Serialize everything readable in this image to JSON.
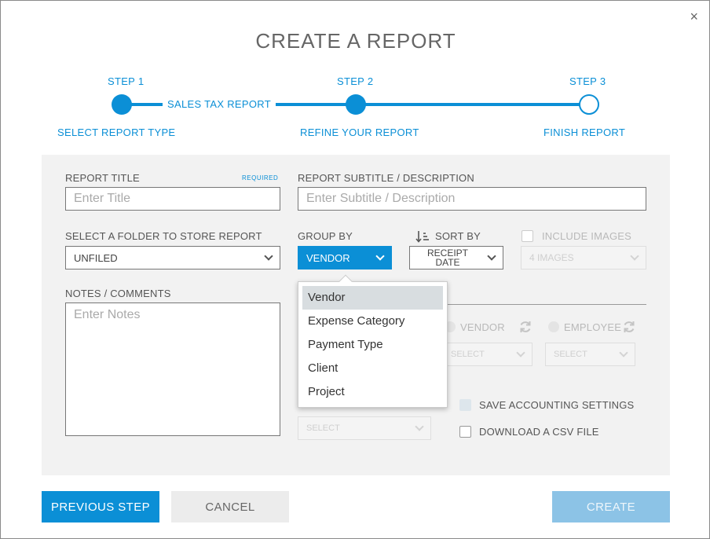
{
  "modal": {
    "title": "CREATE A REPORT",
    "close_glyph": "×"
  },
  "stepper": {
    "steps": [
      {
        "label": "STEP 1",
        "desc": "SELECT REPORT TYPE"
      },
      {
        "label": "STEP 2",
        "desc": "REFINE YOUR REPORT"
      },
      {
        "label": "STEP 3",
        "desc": "FINISH REPORT"
      }
    ],
    "report_type": "SALES TAX REPORT"
  },
  "form": {
    "report_title_label": "REPORT TITLE",
    "required_label": "REQUIRED",
    "report_title_placeholder": "Enter Title",
    "subtitle_label": "REPORT SUBTITLE / DESCRIPTION",
    "subtitle_placeholder": "Enter Subtitle / Description",
    "folder_label": "SELECT A FOLDER TO STORE REPORT",
    "folder_value": "UNFILED",
    "group_by_label": "GROUP BY",
    "group_by_value": "VENDOR",
    "sort_by_label": "SORT BY",
    "sort_by_value_line1": "RECEIPT",
    "sort_by_value_line2": "DATE",
    "include_images_label": "INCLUDE IMAGES",
    "images_value": "4 IMAGES",
    "notes_label": "NOTES / COMMENTS",
    "notes_placeholder": "Enter Notes",
    "vendor_radio_label": "VENDOR",
    "employee_radio_label": "EMPLOYEE",
    "select_placeholder": "SELECT",
    "save_accounting_label": "SAVE ACCOUNTING SETTINGS",
    "download_csv_label": "DOWNLOAD A CSV FILE"
  },
  "group_by_dropdown": {
    "options": [
      "Vendor",
      "Expense Category",
      "Payment Type",
      "Client",
      "Project"
    ],
    "selected_index": 0
  },
  "buttons": {
    "previous": "PREVIOUS STEP",
    "cancel": "CANCEL",
    "create": "CREATE"
  },
  "colors": {
    "accent": "#0b8fd6",
    "panel_bg": "#f2f2f2",
    "create_disabled": "#8cc3e6"
  }
}
